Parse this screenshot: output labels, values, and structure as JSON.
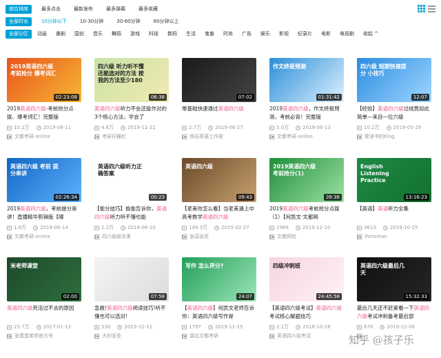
{
  "filters": {
    "sort": [
      {
        "label": "综合排序",
        "active": true
      },
      {
        "label": "最多点击",
        "active": false
      },
      {
        "label": "最新发布",
        "active": false
      },
      {
        "label": "最多弹幕",
        "active": false
      },
      {
        "label": "最多收藏",
        "active": false
      }
    ],
    "duration": [
      {
        "label": "全部时长",
        "active": true
      },
      {
        "label": "10分钟以下",
        "active": false,
        "selected": true
      },
      {
        "label": "10-30分钟",
        "active": false
      },
      {
        "label": "30-60分钟",
        "active": false
      },
      {
        "label": "60分钟以上",
        "active": false
      }
    ],
    "zones": [
      {
        "label": "全部分区",
        "active": true
      },
      {
        "label": "动画"
      },
      {
        "label": "番剧"
      },
      {
        "label": "国创"
      },
      {
        "label": "音乐"
      },
      {
        "label": "舞蹈"
      },
      {
        "label": "游戏"
      },
      {
        "label": "科技"
      },
      {
        "label": "数码"
      },
      {
        "label": "生活"
      },
      {
        "label": "鬼畜"
      },
      {
        "label": "时尚"
      },
      {
        "label": "广告"
      },
      {
        "label": "娱乐"
      },
      {
        "label": "影视"
      },
      {
        "label": "纪录片"
      },
      {
        "label": "电影"
      },
      {
        "label": "电视剧"
      },
      {
        "label": "收起 ^"
      }
    ]
  },
  "videos": [
    {
      "duration": "02:23:08",
      "pre": "2019",
      "kw": "英语四六级",
      "post": "-考前抢分点拨、爆考词汇！完整版",
      "views": "10.2万",
      "date": "2019-06-11",
      "author": "文都考研-online",
      "bg": "#e8541e",
      "bg2": "#f7b733",
      "overlay": "2019英语四六级 考前抢分 爆考词汇"
    },
    {
      "duration": "06:38",
      "pre": "",
      "kw": "英语四六级",
      "post": "听力不会还能作对的3个核心方法，学会了",
      "views": "4.6万",
      "date": "2019-11-22",
      "author": "考研仔栅栏",
      "bg": "#c9e4a8",
      "bg2": "#f2e8b0",
      "overlay": "四六级 听力听不懂 还能选对的方法 按我的方法至少180"
    },
    {
      "duration": "07:02",
      "pre": "零基础快速通过",
      "kw": "英语四六级",
      "post": "",
      "views": "2.7万",
      "date": "2019-06-27",
      "author": "铁谷英语工作室",
      "bg": "#1a1a1a",
      "bg2": "#444444",
      "overlay": ""
    },
    {
      "duration": "01:31:42",
      "pre": "2019",
      "kw": "英语四六级",
      "post": "，作文终极预测，考前必背！完整版",
      "views": "5.0万",
      "date": "2019-06-13",
      "author": "文都考研-online",
      "bg": "#2a8fd8",
      "bg2": "#dff1ff",
      "overlay": "作文终极预测"
    },
    {
      "duration": "12:07",
      "pre": "【经验】",
      "kw": "英语四六级",
      "post": "过线竟如此简单—来自一位六级",
      "views": "10.2万",
      "date": "2019-05-29",
      "author": "爱读书的King",
      "bg": "#2b8ce0",
      "bg2": "#9fd6ff",
      "overlay": "四六级 短期快速提分 小技巧"
    },
    {
      "duration": "02:26:34",
      "pre": "2019",
      "kw": "英语四六级",
      "post": "，考前提分串讲！直播精华剪辑版【哪",
      "views": "1.6万",
      "date": "2019-06-14",
      "author": "文都考研-online",
      "bg": "#1266c4",
      "bg2": "#5fb2ff",
      "overlay": "英语四六级 考前 提分串讲"
    },
    {
      "duration": "00:23",
      "pre": "【偷分技巧】偷偷告诉你，",
      "kw": "英语四六级",
      "post": "听力听不懂也能",
      "views": "2.2万",
      "date": "2019-06-10",
      "author": "四六级部点事",
      "bg": "#ffffff",
      "bg2": "#ffffff",
      "overlay": "英语四六级听力正确答案"
    },
    {
      "duration": "09:43",
      "pre": "【老美你怎么看】当老美遇上中高考数学",
      "kw": "英语四六级",
      "post": "",
      "views": "149.3万",
      "date": "2015-02-27",
      "author": "张逗张花",
      "bg": "#6a4a2a",
      "bg2": "#c8a070",
      "overlay": "英语四六级"
    },
    {
      "duration": "39:38",
      "pre": "2019",
      "kw": "英语四六级",
      "post": "考前抢分点拨（1）【何凯文·文都网",
      "views": "1969",
      "date": "2019-12-10",
      "author": "文都网校",
      "bg": "#1f8f3a",
      "bg2": "#9de0a4",
      "overlay": "2019英语四六级 考前抢分(1)"
    },
    {
      "duration": "13:16:23",
      "pre": "【英语】",
      "kw": "英语",
      "post": "听力全集 ",
      "views": "3613",
      "date": "2019-10-25",
      "author": "lhmeimei",
      "bg": "#1f8a44",
      "bg2": "#137030",
      "overlay": "English Listening Practice"
    },
    {
      "duration": "02:00",
      "pre": "",
      "kw": "英语四六级",
      "post": "死活过不去的原因",
      "views": "23.7万",
      "date": "2017-01-12",
      "author": "张蛋蛋老师官方号",
      "bg": "#1c4a2a",
      "bg2": "#2f6e3e",
      "overlay": "米老师课堂"
    },
    {
      "duration": "07:58",
      "pre": "急救!",
      "kw": "英语四六级",
      "post": "阅读技巧!听不懂也可以选对!",
      "views": "530",
      "date": "2019-12-12",
      "author": "大的圣圣",
      "bg": "#f4f4f4",
      "bg2": "#dcdcdc",
      "overlay": ""
    },
    {
      "duration": "24:07",
      "pre": "【",
      "kw": "英语四六级",
      "post": "】何凯文老师告诉你：英语四六级写作是",
      "views": "1797",
      "date": "2019-11-15",
      "author": "湖北文都考研",
      "bg": "#22a05a",
      "bg2": "#9de5b9",
      "overlay": "写作 怎么评分?"
    },
    {
      "duration": "24:45:58",
      "pre": "【英语四六级考试】",
      "kw": "英语四六级",
      "post": "考试核心解题技巧",
      "views": "2.1万",
      "date": "2018-10-28",
      "author": "英语四六级考试",
      "bg": "#f7d5df",
      "bg2": "#fdf2f5",
      "overlay": "四级冲刺班"
    },
    {
      "duration": "15:32:33",
      "pre": "最后几天还不赶紧看一下",
      "kw": "英语四六级",
      "post": "考试冲刺备考最后部",
      "views": "678",
      "date": "2019-12-06",
      "author": "",
      "bg": "#0f0f0f",
      "bg2": "#262626",
      "overlay": "英语四六级最后几天"
    }
  ],
  "watermark": "知乎 @孩子乐"
}
